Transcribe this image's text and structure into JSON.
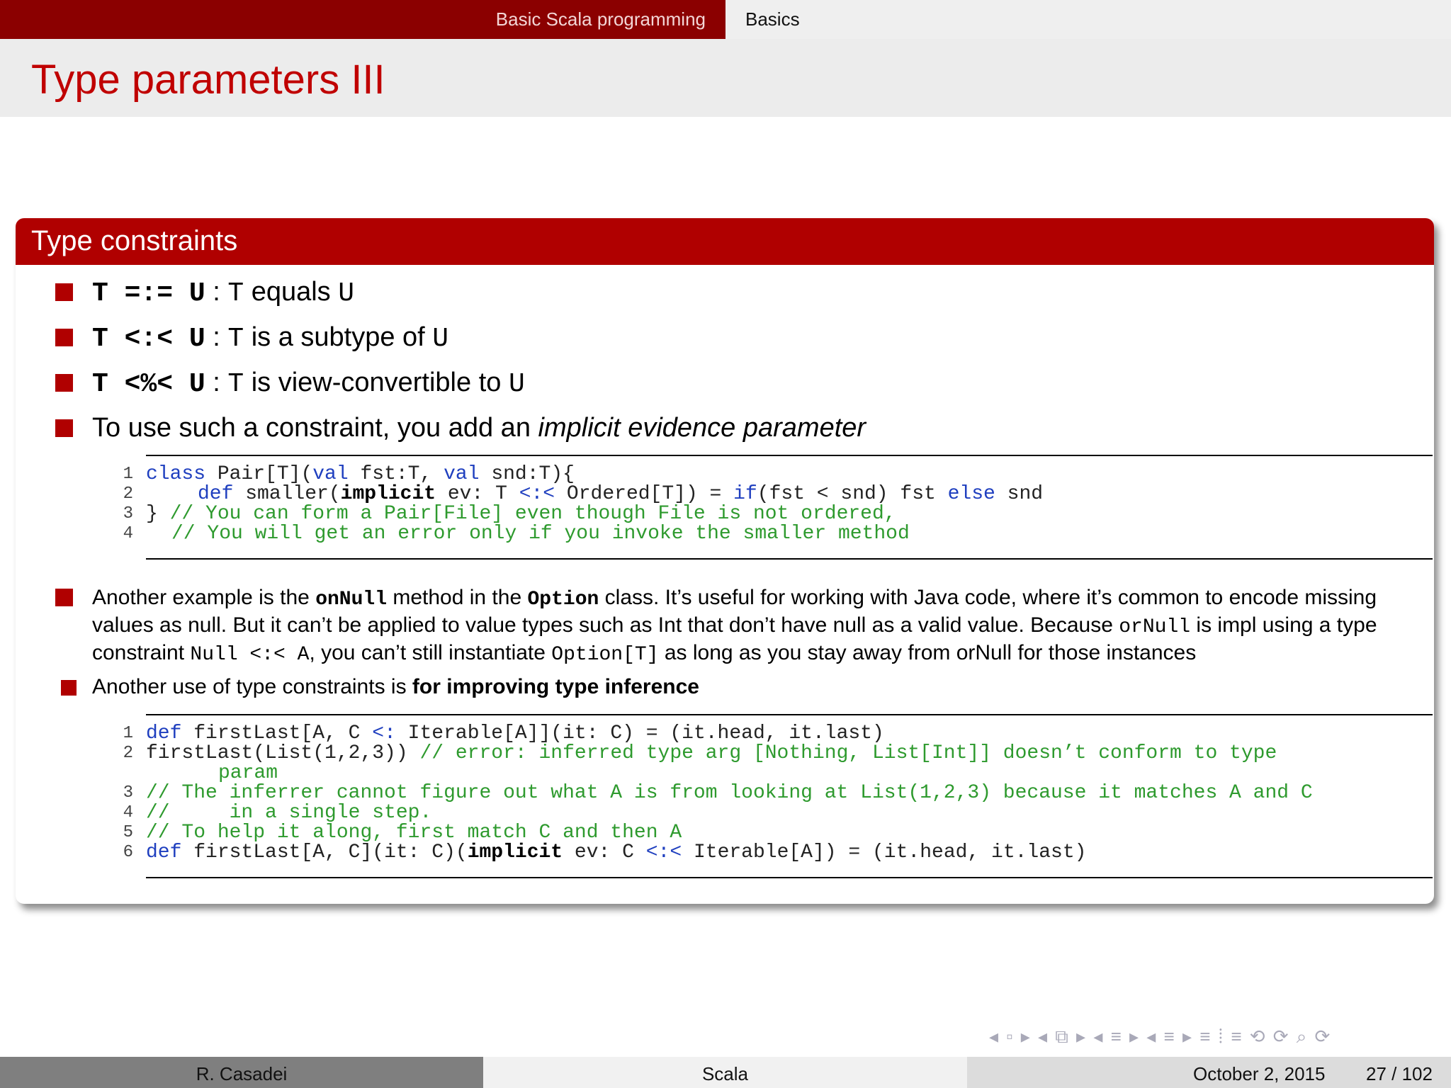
{
  "header": {
    "section": "Basic Scala programming",
    "subsection": "Basics"
  },
  "frame_title": "Type parameters III",
  "block": {
    "title": "Type constraints",
    "bullets": [
      {
        "code": "T =:= U",
        "sep": " : ",
        "a": "T",
        "text": " equals ",
        "b": "U"
      },
      {
        "code": "T <:< U",
        "sep": " : ",
        "a": "T",
        "text": " is a subtype of ",
        "b": "U"
      },
      {
        "code": "T <%< U",
        "sep": " : ",
        "a": "T",
        "text": " is view-convertible to ",
        "b": "U"
      }
    ],
    "evidence": {
      "prefix": "To use such a constraint, you add an ",
      "emph": "implicit evidence parameter"
    },
    "listing1": {
      "numbers": [
        "1",
        "2",
        "3",
        "4"
      ],
      "l1": {
        "kw1": "class",
        "t1": " Pair[T](",
        "kw2": "val",
        "t2": " fst:T, ",
        "kw3": "val",
        "t3": " snd:T){"
      },
      "l2": {
        "kw1": "def",
        "t1": " smaller(",
        "b1": "implicit",
        "t2": " ev: T ",
        "op": "<:<",
        "t3": " Ordered[T]) = ",
        "kw2": "if",
        "t4": "(fst < snd) fst ",
        "kw3": "else",
        "t5": " snd"
      },
      "l3": {
        "t1": "} ",
        "c1": "// You can form a Pair[File] even though File is not ordered,"
      },
      "l4": {
        "c1": "// You will get an error only if you invoke the smaller method"
      }
    },
    "onnull": {
      "p1": "Another example is the ",
      "m1": "onNull",
      "p2": " method in the ",
      "m2": "Option",
      "p3": " class. It’s useful for working with Java code, where it’s common to encode missing values as null. But it can’t be applied to value types such as Int that don’t have null as a valid value. Because ",
      "m3": "orNull",
      "p4": " is impl using a type constraint ",
      "m4": "Null <:< A",
      "p5": ", you can’t still instantiate ",
      "m5": "Option[T]",
      "p6": " as long as you stay away from orNull for those instances"
    },
    "inference": {
      "p1": "Another use of type constraints is ",
      "b1": "for improving type inference"
    },
    "listing2": {
      "numbers": [
        "1",
        "2",
        "3",
        "4",
        "5",
        "6"
      ],
      "l1": {
        "kw1": "def",
        "t1": " firstLast[A, C ",
        "op": "<:",
        "t2": " Iterable[A]](it: C) = (it.head, it.last)"
      },
      "l2": {
        "t1": "firstLast(List(1,2,3)) ",
        "c1": "// error: inferred type arg [Nothing, List[Int]] doesn’t conform to type"
      },
      "l2b": {
        "c1": "param"
      },
      "l3": {
        "c1": "// The inferrer cannot figure out what A is from looking at List(1,2,3) because it matches A and C"
      },
      "l4": {
        "c1": "//     in a single step."
      },
      "l5": {
        "c1": "// To help it along, first match C and then A"
      },
      "l6": {
        "kw1": "def",
        "t1": " firstLast[A, C](it: C)(",
        "b1": "implicit",
        "t2": " ev: C ",
        "op": "<:<",
        "t3": " Iterable[A]) = (it.head, it.last)"
      }
    }
  },
  "nav_symbols": "◂ ▫ ▸ ◂ ⧉ ▸ ◂ ≡ ▸ ◂ ≡ ▸ ≡ ⦙ ≡ ⟲ ⟳ ⌕ ⟳",
  "footer": {
    "author": "R. Casadei",
    "title": "Scala",
    "date": "October 2, 2015",
    "page": "27 / 102"
  }
}
